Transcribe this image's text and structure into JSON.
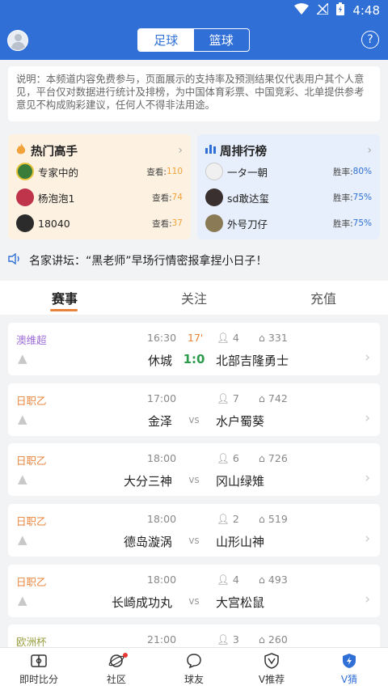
{
  "statusbar": {
    "time": "4:48"
  },
  "header": {
    "tabs": [
      "足球",
      "篮球"
    ],
    "help": "?"
  },
  "notice": {
    "text": "说明：本频道内容免费参与，页面展示的支持率及预测结果仅代表用户其个人意见，平台仅对数据进行统计及排榜，为中国体育彩票、中国竞彩、北单提供参考意见不构成购彩建议，任何人不得非法用途。"
  },
  "hot": {
    "title": "热门高手",
    "rows": [
      {
        "name": "专家中的",
        "label": "查看:",
        "count": "110"
      },
      {
        "name": "杨泡泡1",
        "label": "查看:",
        "count": "74"
      },
      {
        "name": "18040",
        "label": "查看:",
        "count": "37"
      }
    ]
  },
  "rank": {
    "title": "周排行榜",
    "rows": [
      {
        "name": "一タ一朝",
        "label": "胜率:",
        "rate": "80%"
      },
      {
        "name": "sd敢达玺",
        "label": "胜率:",
        "rate": "75%"
      },
      {
        "name": "外号刀仔",
        "label": "胜率:",
        "rate": "75%"
      }
    ]
  },
  "news": {
    "text": "名家讲坛：“黑老师”早场行情密报拿捏小日子！"
  },
  "tabs": [
    "赛事",
    "关注",
    "充值"
  ],
  "matches": [
    {
      "league": "澳维超",
      "time": "16:30",
      "minute": "17'",
      "c1": "4",
      "c2": "331",
      "home": "休城",
      "mid": "1:0",
      "away": "北部吉隆勇士"
    },
    {
      "league": "日职乙",
      "time": "17:00",
      "minute": "",
      "c1": "7",
      "c2": "742",
      "home": "金泽",
      "mid": "vs",
      "away": "水户蜀葵"
    },
    {
      "league": "日职乙",
      "time": "18:00",
      "minute": "",
      "c1": "6",
      "c2": "726",
      "home": "大分三神",
      "mid": "vs",
      "away": "冈山绿雉"
    },
    {
      "league": "日职乙",
      "time": "18:00",
      "minute": "",
      "c1": "2",
      "c2": "519",
      "home": "德岛漩涡",
      "mid": "vs",
      "away": "山形山神"
    },
    {
      "league": "日职乙",
      "time": "18:00",
      "minute": "",
      "c1": "4",
      "c2": "493",
      "home": "长崎成功丸",
      "mid": "vs",
      "away": "大宫松鼠"
    },
    {
      "league": "欧洲杯",
      "time": "21:00",
      "minute": "",
      "c1": "3",
      "c2": "260",
      "home": "",
      "mid": "",
      "away": ""
    }
  ],
  "bottom_nav": [
    "即时比分",
    "社区",
    "球友",
    "V推荐",
    "V猜"
  ],
  "colors": {
    "brand": "#2f6fd6",
    "accent": "#e8833a",
    "score": "#2c9b4b"
  }
}
